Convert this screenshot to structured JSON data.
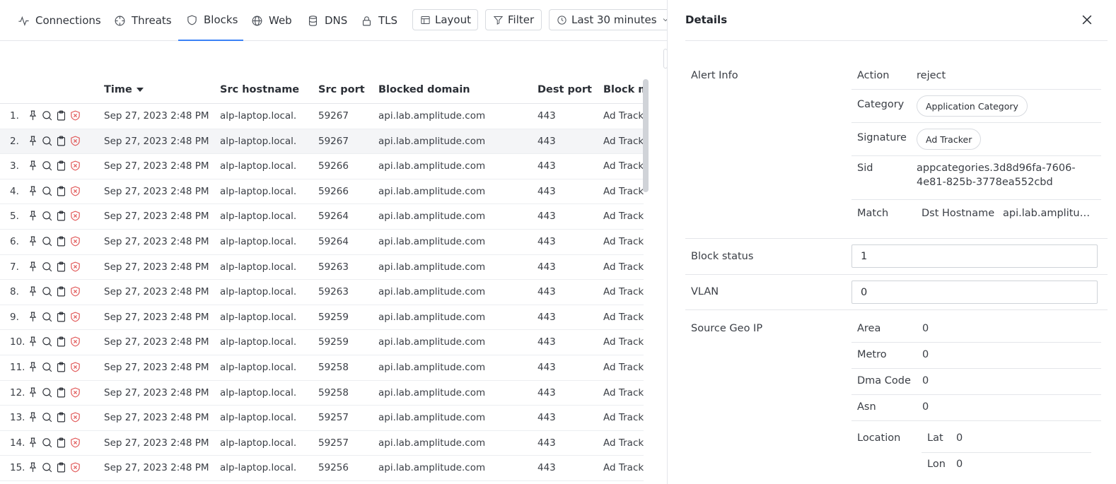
{
  "tabs": [
    {
      "label": "Connections",
      "icon": "activity-icon"
    },
    {
      "label": "Threats",
      "icon": "crosshair-icon"
    },
    {
      "label": "Blocks",
      "icon": "shield-icon"
    },
    {
      "label": "Web",
      "icon": "globe-icon"
    },
    {
      "label": "DNS",
      "icon": "database-icon"
    },
    {
      "label": "TLS",
      "icon": "lock-icon"
    }
  ],
  "active_tab": "Blocks",
  "toolbar": {
    "layout_label": "Layout",
    "filter_label": "Filter",
    "timerange_label": "Last 30 minutes"
  },
  "table": {
    "columns": [
      "Time",
      "Src hostname",
      "Src port",
      "Blocked domain",
      "Dest port",
      "Block me"
    ],
    "sorted_column": "Time",
    "sort_direction": "descending",
    "rows": [
      {
        "idx": "1.",
        "time": "Sep 27, 2023 2:48 PM",
        "src": "alp-laptop.local.",
        "sport": "59267",
        "domain": "api.lab.amplitude.com",
        "dport": "443",
        "method": "Ad Tracke"
      },
      {
        "idx": "2.",
        "time": "Sep 27, 2023 2:48 PM",
        "src": "alp-laptop.local.",
        "sport": "59267",
        "domain": "api.lab.amplitude.com",
        "dport": "443",
        "method": "Ad Tracke"
      },
      {
        "idx": "3.",
        "time": "Sep 27, 2023 2:48 PM",
        "src": "alp-laptop.local.",
        "sport": "59266",
        "domain": "api.lab.amplitude.com",
        "dport": "443",
        "method": "Ad Tracke"
      },
      {
        "idx": "4.",
        "time": "Sep 27, 2023 2:48 PM",
        "src": "alp-laptop.local.",
        "sport": "59266",
        "domain": "api.lab.amplitude.com",
        "dport": "443",
        "method": "Ad Tracke"
      },
      {
        "idx": "5.",
        "time": "Sep 27, 2023 2:48 PM",
        "src": "alp-laptop.local.",
        "sport": "59264",
        "domain": "api.lab.amplitude.com",
        "dport": "443",
        "method": "Ad Tracke"
      },
      {
        "idx": "6.",
        "time": "Sep 27, 2023 2:48 PM",
        "src": "alp-laptop.local.",
        "sport": "59264",
        "domain": "api.lab.amplitude.com",
        "dport": "443",
        "method": "Ad Tracke"
      },
      {
        "idx": "7.",
        "time": "Sep 27, 2023 2:48 PM",
        "src": "alp-laptop.local.",
        "sport": "59263",
        "domain": "api.lab.amplitude.com",
        "dport": "443",
        "method": "Ad Tracke"
      },
      {
        "idx": "8.",
        "time": "Sep 27, 2023 2:48 PM",
        "src": "alp-laptop.local.",
        "sport": "59263",
        "domain": "api.lab.amplitude.com",
        "dport": "443",
        "method": "Ad Tracke"
      },
      {
        "idx": "9.",
        "time": "Sep 27, 2023 2:48 PM",
        "src": "alp-laptop.local.",
        "sport": "59259",
        "domain": "api.lab.amplitude.com",
        "dport": "443",
        "method": "Ad Tracke"
      },
      {
        "idx": "10.",
        "time": "Sep 27, 2023 2:48 PM",
        "src": "alp-laptop.local.",
        "sport": "59259",
        "domain": "api.lab.amplitude.com",
        "dport": "443",
        "method": "Ad Tracke"
      },
      {
        "idx": "11.",
        "time": "Sep 27, 2023 2:48 PM",
        "src": "alp-laptop.local.",
        "sport": "59258",
        "domain": "api.lab.amplitude.com",
        "dport": "443",
        "method": "Ad Tracke"
      },
      {
        "idx": "12.",
        "time": "Sep 27, 2023 2:48 PM",
        "src": "alp-laptop.local.",
        "sport": "59258",
        "domain": "api.lab.amplitude.com",
        "dport": "443",
        "method": "Ad Tracke"
      },
      {
        "idx": "13.",
        "time": "Sep 27, 2023 2:48 PM",
        "src": "alp-laptop.local.",
        "sport": "59257",
        "domain": "api.lab.amplitude.com",
        "dport": "443",
        "method": "Ad Tracke"
      },
      {
        "idx": "14.",
        "time": "Sep 27, 2023 2:48 PM",
        "src": "alp-laptop.local.",
        "sport": "59257",
        "domain": "api.lab.amplitude.com",
        "dport": "443",
        "method": "Ad Tracke"
      },
      {
        "idx": "15.",
        "time": "Sep 27, 2023 2:48 PM",
        "src": "alp-laptop.local.",
        "sport": "59256",
        "domain": "api.lab.amplitude.com",
        "dport": "443",
        "method": "Ad Tracke"
      }
    ],
    "row_action_icons": [
      "pin-icon",
      "search-icon",
      "clipboard-icon",
      "block-shield-icon"
    ],
    "highlighted_row": "2."
  },
  "details": {
    "title": "Details",
    "alert_info": {
      "section_label": "Alert Info",
      "action_label": "Action",
      "action_value": "reject",
      "category_label": "Category",
      "category_value": "Application Category",
      "signature_label": "Signature",
      "signature_value": "Ad Tracker",
      "sid_label": "Sid",
      "sid_value_line1": "appcategories.3d8d96fa-7606-",
      "sid_value_line2": "4e81-825b-3778ea552cbd",
      "match_label": "Match",
      "match_key": "Dst Hostname",
      "match_value": "api.lab.amplitu…"
    },
    "block_status": {
      "label": "Block status",
      "value": "1"
    },
    "vlan": {
      "label": "VLAN",
      "value": "0"
    },
    "source_geo_ip": {
      "section_label": "Source Geo IP",
      "area_label": "Area",
      "area_value": "0",
      "metro_label": "Metro",
      "metro_value": "0",
      "dma_label": "Dma Code",
      "dma_value": "0",
      "asn_label": "Asn",
      "asn_value": "0",
      "location_label": "Location",
      "lat_label": "Lat",
      "lat_value": "0",
      "lon_label": "Lon",
      "lon_value": "0"
    }
  },
  "colors": {
    "accent": "#3b82f6",
    "block_icon": "#e05252",
    "highlight_row": "#f4f5f7"
  }
}
